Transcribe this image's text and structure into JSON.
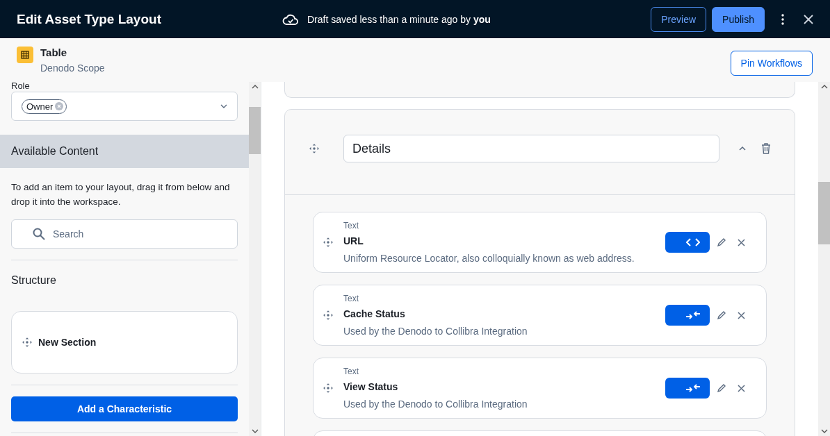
{
  "header": {
    "title": "Edit Asset Type Layout",
    "status": "Draft saved less than a minute ago by **you**",
    "buttons": [
      {
        "label": "Preview",
        "kind": "outline"
      },
      {
        "label": "Publish",
        "kind": "primary"
      }
    ]
  },
  "asset": {
    "name": "Table",
    "scope": "Denodo Scope",
    "action": "Pin Workflows"
  },
  "sidebar": {
    "role_label": "Role",
    "role_tags": [
      "Owner"
    ],
    "available_title": "Available Content",
    "hint": "To add an item to your layout, drag it from below and drop it into the workspace.",
    "search_placeholder": "Search",
    "structure_title": "Structure",
    "structure_items": [
      "New Section"
    ],
    "add_button": "Add a Characteristic"
  },
  "section": {
    "title": "Details",
    "expanded": true,
    "items": [
      {
        "type": "Text",
        "name": "URL",
        "description": "Uniform Resource Locator, also colloquially known as web address.",
        "kind": "code"
      },
      {
        "type": "Text",
        "name": "Cache Status",
        "description": "Used by the Denodo to Collibra Integration",
        "kind": "sync"
      },
      {
        "type": "Text",
        "name": "View Status",
        "description": "Used by the Denodo to Collibra Integration",
        "kind": "sync"
      }
    ]
  }
}
